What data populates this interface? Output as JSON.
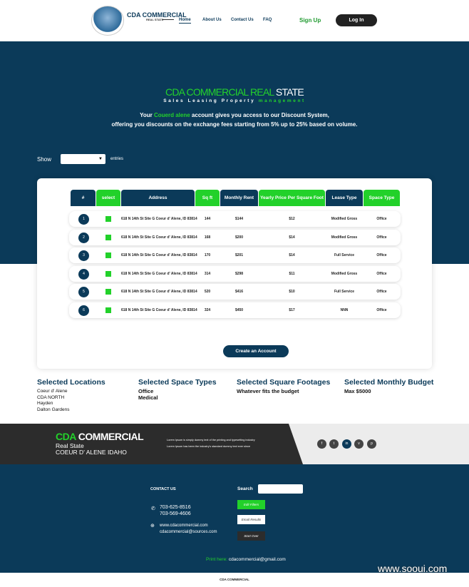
{
  "header": {
    "brand": "CDA COMMERCIAL",
    "brand_sub": "REAL STATE",
    "nav": [
      "Home",
      "About Us",
      "Contact Us",
      "FAQ"
    ],
    "signup": "Sign Up",
    "login": "Log In"
  },
  "hero": {
    "title_green": "CDA COMMERCIAL REAL",
    "title_white": "STATE",
    "tagline_white": "Sales Leasing Property",
    "tagline_green": "management",
    "intro_1a": "Your",
    "intro_1b": "Couerd alene",
    "intro_1c": "account gives you access to our Discount System,",
    "intro_2": "offering you discounts on the exchange fees starting from 5% up to 25% based on volume."
  },
  "entries": {
    "show": "Show",
    "entries": "entries",
    "selected": ""
  },
  "table": {
    "headers": [
      "#",
      "select",
      "Address",
      "Sq ft",
      "Monthly Rent",
      "Yearly Price Per Square Foot",
      "Lease Type",
      "Space Type"
    ],
    "rows": [
      {
        "n": "1",
        "address": "618 N 14th St Site G Coeur d' Alene, ID 83814",
        "sqft": "144",
        "rent": "$144",
        "yearly": "$12",
        "lease": "Modified Gross",
        "space": "Office",
        "selected": true
      },
      {
        "n": "2",
        "address": "618 N 14th St Site G Coeur d' Alene, ID 83814",
        "sqft": "168",
        "rent": "$200",
        "yearly": "$14",
        "lease": "Modified Gross",
        "space": "Office",
        "selected": true
      },
      {
        "n": "3",
        "address": "618 N 14th St Site G Coeur d' Alene, ID 83814",
        "sqft": "170",
        "rent": "$201",
        "yearly": "$14",
        "lease": "Full Service",
        "space": "Office",
        "selected": true
      },
      {
        "n": "4",
        "address": "618 N 14th St Site G Coeur d' Alene, ID 83814",
        "sqft": "314",
        "rent": "$298",
        "yearly": "$11",
        "lease": "Modified Gross",
        "space": "Office",
        "selected": true
      },
      {
        "n": "5",
        "address": "618 N 14th St Site G Coeur d' Alene, ID 83814",
        "sqft": "520",
        "rent": "$416",
        "yearly": "$10",
        "lease": "Full Service",
        "space": "Office",
        "selected": true
      },
      {
        "n": "6",
        "address": "618 N 14th St Site G Coeur d' Alene, ID 83814",
        "sqft": "324",
        "rent": "$450",
        "yearly": "$17",
        "lease": "NNN",
        "space": "Office",
        "selected": true
      }
    ]
  },
  "create_account": "Create an Account",
  "selected": [
    {
      "title": "Selected Locations",
      "values": [
        "Coeur d' Alene",
        "CDA NORTH",
        "Hayden",
        "Dalton Gardens"
      ]
    },
    {
      "title": "Selected Space Types",
      "values": [
        "Office",
        "Medical"
      ]
    },
    {
      "title": "Selected Square Footages",
      "values": [
        "Whatever fits the budget"
      ]
    },
    {
      "title": "Selected Monthly Budget",
      "values": [
        "Max $5000"
      ]
    }
  ],
  "band": {
    "green": "CDA",
    "white": "COMMERCIAL",
    "line2": "Real State",
    "line3": "COEUR D' ALENE IDAHO",
    "lorem1": "Lorem Ipsum is simply dummy text of the printing and typesetting industry",
    "lorem2": "Lorem Ipsum has been the industry's standard dummy text ever since",
    "social": [
      "f",
      "t",
      "in",
      "v",
      "p"
    ]
  },
  "footer": {
    "contact_title": "CONTACT US",
    "phone1": "703-625-8516",
    "phone2": "703-569-4606",
    "web": "www.cdacommercial.com",
    "email": "cdacommercial@sources.com",
    "search_label": "Search",
    "search_value": "",
    "edit": "Edit Filters",
    "emailres": "Email Results",
    "start": "Start Over",
    "print_label": "Print here:",
    "print_email": "cdacommercial@gmail.com",
    "bottom": "CDA COMMERCIAL"
  },
  "watermark": "www.sooui.com",
  "colors": {
    "navy": "#0b3a59",
    "green": "#22d12a"
  }
}
